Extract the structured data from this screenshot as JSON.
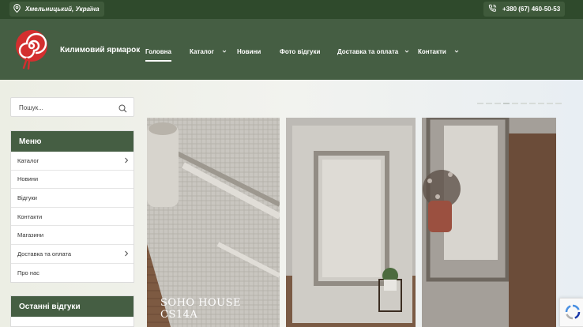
{
  "topbar": {
    "location": "Хмельницький, Україна",
    "phone": "+380 (67) 460-50-53"
  },
  "header": {
    "brand": "Килимовий ярмарок",
    "nav": [
      {
        "label": "Головна",
        "active": true,
        "dropdown": false
      },
      {
        "label": "Каталог",
        "active": false,
        "dropdown": true
      },
      {
        "label": "Новини",
        "active": false,
        "dropdown": false
      },
      {
        "label": "Фото відгуки",
        "active": false,
        "dropdown": false
      },
      {
        "label": "Доставка та оплата",
        "active": false,
        "dropdown": true
      },
      {
        "label": "Контакти",
        "active": false,
        "dropdown": true
      }
    ]
  },
  "search": {
    "placeholder": "Пошук..."
  },
  "sidebar_menu": {
    "title": "Меню",
    "items": [
      {
        "label": "Каталог",
        "has_children": true
      },
      {
        "label": "Новини",
        "has_children": false
      },
      {
        "label": "Відгуки",
        "has_children": false
      },
      {
        "label": "Контакти",
        "has_children": false
      },
      {
        "label": "Магазини",
        "has_children": false
      },
      {
        "label": "Доставка та оплата",
        "has_children": true
      },
      {
        "label": "Про нас",
        "has_children": false
      }
    ]
  },
  "reviews": {
    "title": "Останні відгуки"
  },
  "slider": {
    "caption": "SOHO HOUSE CS14A",
    "dot_count": 10,
    "active_dot": 3
  },
  "colors": {
    "topbar": "#2f4a2c",
    "header": "#455e43",
    "accent": "#d32f2f"
  }
}
